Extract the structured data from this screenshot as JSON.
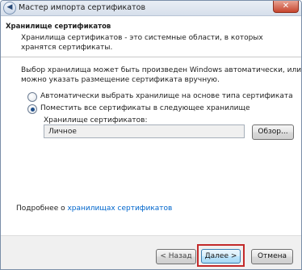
{
  "window": {
    "title": "Мастер импорта сертификатов",
    "close_glyph": "✕",
    "back_glyph": "◀"
  },
  "header": {
    "title": "Хранилище сертификатов",
    "description": "Хранилища сертификатов - это системные области, в которых хранятся сертификаты."
  },
  "content": {
    "description_line1": "Выбор хранилища может быть произведен Windows автоматически, или же",
    "description_line2": "можно указать размещение сертификата вручную.",
    "radio_auto_label": "Автоматически выбрать хранилище на основе типа сертификата",
    "radio_manual_label": "Поместить все сертификаты в следующее хранилище",
    "radio_selected": "manual",
    "store_label": "Хранилище сертификатов:",
    "store_value": "Личное",
    "browse_label": "Обзор...",
    "more_prefix": "Подробнее о ",
    "more_link": "хранилищах сертификатов"
  },
  "footer": {
    "back_label": "< Назад",
    "next_label": "Далее >",
    "cancel_label": "Отмена"
  }
}
